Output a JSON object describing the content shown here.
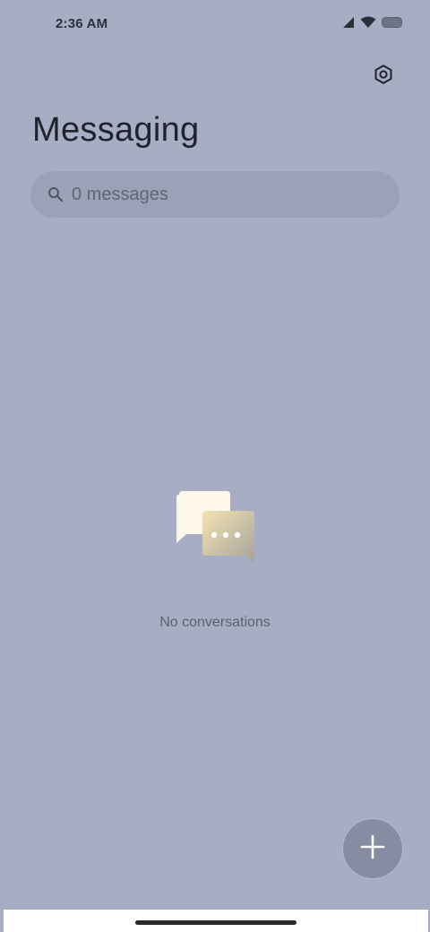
{
  "status_bar": {
    "time": "2:36 AM",
    "icons": [
      "cell-signal-icon",
      "wifi-icon",
      "battery-icon"
    ]
  },
  "header": {
    "title": "Messaging",
    "settings_icon": "gear-icon"
  },
  "search": {
    "placeholder": "0 messages",
    "icon": "search-icon"
  },
  "empty_state": {
    "icon": "chat-bubbles-icon",
    "text": "No conversations"
  },
  "fab": {
    "icon": "plus-icon"
  },
  "colors": {
    "background": "#a7aec4",
    "search_background": "#9ba2b7",
    "fab_background": "#868ca2",
    "title_text": "#20232c"
  }
}
